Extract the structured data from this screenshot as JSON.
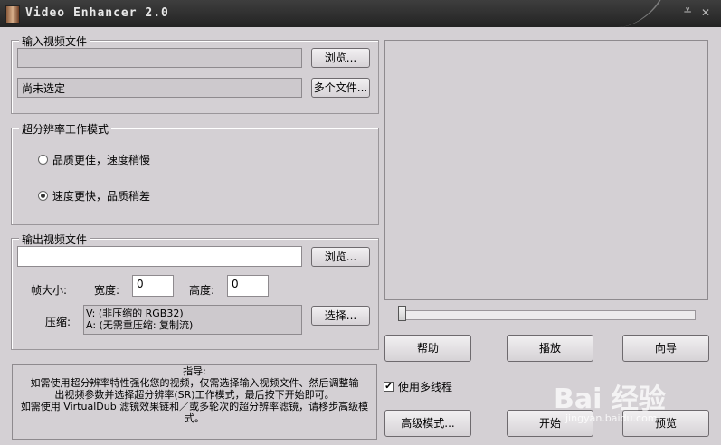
{
  "window": {
    "title": "Video Enhancer 2.0"
  },
  "input_group": {
    "legend": "输入视频文件",
    "path_value": "",
    "browse_label": "浏览...",
    "status": "尚未选定",
    "multi_label": "多个文件..."
  },
  "mode_group": {
    "legend": "超分辨率工作模式",
    "options": [
      {
        "label": "品质更佳，速度稍慢",
        "selected": false
      },
      {
        "label": "速度更快，品质稍差",
        "selected": true
      }
    ]
  },
  "output_group": {
    "legend": "输出视频文件",
    "path_value": "",
    "browse_label": "浏览...",
    "frame_size_label": "帧大小:",
    "width_label": "宽度:",
    "width_value": "0",
    "height_label": "高度:",
    "height_value": "0",
    "compress_label": "压缩:",
    "compress_v": "V: (非压缩的 RGB32)",
    "compress_a": "A: (无需重压缩: 复制流)",
    "select_label": "选择..."
  },
  "guide": {
    "title": "指导:",
    "line1": "如需使用超分辨率特性强化您的视频，仅需选择输入视频文件、然后调整输",
    "line2": "出视频参数并选择超分辨率(SR)工作模式，最后按下开始即可。",
    "line3": "如需使用 VirtualDub 滤镜效果链和／或多轮次的超分辨率滤镜，请移步高级模",
    "line4": "式。"
  },
  "buttons": {
    "help": "帮助",
    "play": "播放",
    "wizard": "向导",
    "advanced": "高级模式...",
    "start": "开始",
    "preview": "预览"
  },
  "multithread": {
    "label": "使用多线程",
    "checked": true
  },
  "slider": {
    "value": 0
  },
  "watermark": {
    "text": "Bai 经验",
    "url": "jingyan.baidu.com"
  },
  "icons": [
    "app-icon",
    "minimize-icon",
    "close-icon",
    "check-icon"
  ]
}
